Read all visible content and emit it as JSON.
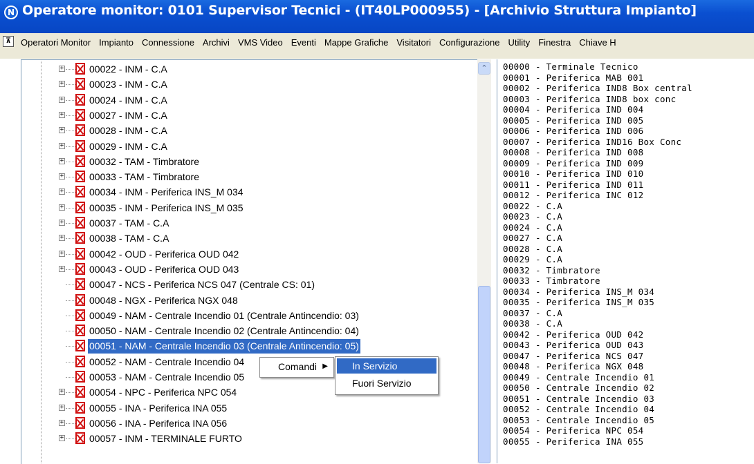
{
  "window": {
    "title": "Operatore monitor: 0101 Supervisor Tecnici - (IT40LP000955) - [Archivio Struttura Impianto]",
    "app_icon": "N"
  },
  "menubar": {
    "items": [
      "Operatori Monitor",
      "Impianto",
      "Connessione",
      "Archivi",
      "VMS Video",
      "Eventi",
      "Mappe Grafiche",
      "Visitatori",
      "Configurazione",
      "Utility",
      "Finestra",
      "Chiave H"
    ]
  },
  "tree": {
    "items": [
      {
        "label": "00022 - INM - C.A",
        "expandable": true
      },
      {
        "label": "00023 - INM - C.A",
        "expandable": true
      },
      {
        "label": "00024 - INM - C.A",
        "expandable": true
      },
      {
        "label": "00027 - INM - C.A",
        "expandable": true
      },
      {
        "label": "00028 - INM - C.A",
        "expandable": true
      },
      {
        "label": "00029 - INM - C.A",
        "expandable": true
      },
      {
        "label": "00032 - TAM - Timbratore",
        "expandable": true
      },
      {
        "label": "00033 - TAM - Timbratore",
        "expandable": true
      },
      {
        "label": "00034 - INM - Periferica INS_M 034",
        "expandable": true
      },
      {
        "label": "00035 - INM - Periferica INS_M 035",
        "expandable": true
      },
      {
        "label": "00037 - TAM - C.A",
        "expandable": true
      },
      {
        "label": "00038 - TAM - C.A",
        "expandable": true
      },
      {
        "label": "00042 - OUD - Periferica OUD 042",
        "expandable": true
      },
      {
        "label": "00043 - OUD - Periferica OUD 043",
        "expandable": true
      },
      {
        "label": "00047 - NCS - Periferica NCS 047 (Centrale CS: 01)",
        "expandable": false
      },
      {
        "label": "00048 - NGX - Periferica NGX 048",
        "expandable": false
      },
      {
        "label": "00049 - NAM - Centrale Incendio 01 (Centrale Antincendio: 03)",
        "expandable": false
      },
      {
        "label": "00050 - NAM - Centrale Incendio 02 (Centrale Antincendio: 04)",
        "expandable": false
      },
      {
        "label": "00051 - NAM - Centrale Incendio 03 (Centrale Antincendio: 05)",
        "expandable": false,
        "selected": true
      },
      {
        "label": "00052 - NAM - Centrale Incendio 04",
        "expandable": false
      },
      {
        "label": "00053 - NAM - Centrale Incendio 05",
        "expandable": false
      },
      {
        "label": "00054 - NPC - Periferica NPC 054",
        "expandable": true
      },
      {
        "label": "00055 - INA - Periferica INA 055",
        "expandable": true
      },
      {
        "label": "00056 - INA - Periferica INA 056",
        "expandable": true
      },
      {
        "label": "00057 - INM - TERMINALE FURTO",
        "expandable": true
      }
    ]
  },
  "list": {
    "items": [
      "00000 - Terminale Tecnico",
      "00001 - Periferica MAB 001",
      "00002 - Periferica IND8 Box central",
      "00003 - Periferica IND8 box conc",
      "00004 - Periferica IND 004",
      "00005 - Periferica IND 005",
      "00006 - Periferica IND 006",
      "00007 - Periferica IND16 Box Conc",
      "00008 - Periferica IND 008",
      "00009 - Periferica IND 009",
      "00010 - Periferica IND 010",
      "00011 - Periferica IND 011",
      "00012 - Periferica INC 012",
      "00022 - C.A",
      "00023 - C.A",
      "00024 - C.A",
      "00027 - C.A",
      "00028 - C.A",
      "00029 - C.A",
      "00032 - Timbratore",
      "00033 - Timbratore",
      "00034 - Periferica INS_M 034",
      "00035 - Periferica INS_M 035",
      "00037 - C.A",
      "00038 - C.A",
      "00042 - Periferica OUD 042",
      "00043 - Periferica OUD 043",
      "00047 - Periferica NCS 047",
      "00048 - Periferica NGX 048",
      "00049 - Centrale Incendio 01",
      "00050 - Centrale Incendio 02",
      "00051 - Centrale Incendio 03",
      "00052 - Centrale Incendio 04",
      "00053 - Centrale Incendio 05",
      "00054 - Periferica NPC 054",
      "00055 - Periferica INA 055"
    ]
  },
  "context_menu": {
    "label": "Comandi",
    "submenu": [
      "In Servizio",
      "Fuori Servizio"
    ],
    "highlighted": "In Servizio"
  }
}
